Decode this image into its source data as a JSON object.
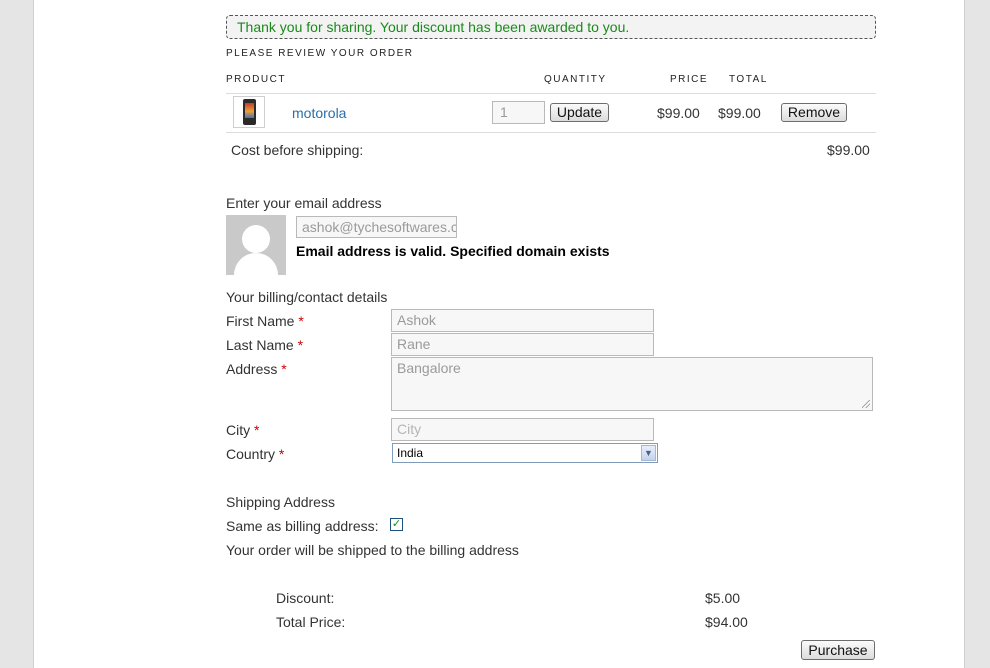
{
  "notice": {
    "text": "Thank you for sharing. Your discount has been awarded to you."
  },
  "review": {
    "heading": "PLEASE REVIEW YOUR ORDER"
  },
  "cart": {
    "headers": {
      "product": "PRODUCT",
      "quantity": "QUANTITY",
      "price": "PRICE",
      "total": "TOTAL"
    },
    "items": [
      {
        "name": "motorola",
        "quantity": "1",
        "update_label": "Update",
        "price": "$99.00",
        "total": "$99.00",
        "remove_label": "Remove"
      }
    ],
    "cost_label": "Cost before shipping:",
    "cost_value": "$99.00"
  },
  "email": {
    "label": "Enter your email address",
    "value": "ashok@tychesoftwares.com",
    "status": "Email address is valid. Specified domain exists"
  },
  "billing": {
    "heading": "Your billing/contact details",
    "required_mark": "*",
    "first_name": {
      "label": "First Name",
      "value": "Ashok"
    },
    "last_name": {
      "label": "Last Name",
      "value": "Rane"
    },
    "address": {
      "label": "Address",
      "value": "Bangalore"
    },
    "city": {
      "label": "City",
      "placeholder": "City"
    },
    "country": {
      "label": "Country",
      "selected": "India"
    }
  },
  "shipping": {
    "heading": "Shipping Address",
    "same_label": "Same as billing address:",
    "same_checked": true,
    "note": "Your order will be shipped to the billing address"
  },
  "summary": {
    "discount_label": "Discount:",
    "discount_value": "$5.00",
    "total_label": "Total Price:",
    "total_value": "$94.00"
  },
  "purchase_label": "Purchase",
  "icons": {
    "avatar": "default-avatar-icon",
    "product": "phone-thumbnail-icon",
    "dropdown": "chevron-down-icon",
    "check": "checkmark-icon"
  },
  "colors": {
    "notice_text": "#1b8a1b",
    "link": "#2a6fa8",
    "required": "#cc0000"
  }
}
